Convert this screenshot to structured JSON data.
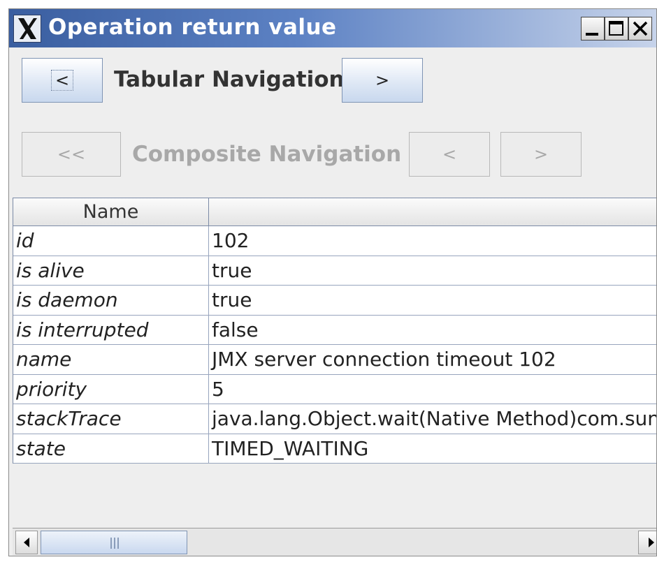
{
  "window": {
    "title": "Operation return value",
    "icon": "x-app-icon",
    "controls": [
      "minimize-icon",
      "maximize-icon",
      "close-icon"
    ]
  },
  "tabular_nav": {
    "prev_label": "<",
    "label": "Tabular Navigation",
    "next_label": ">"
  },
  "composite_nav": {
    "first_label": "<<",
    "label": "Composite Navigation",
    "prev_label": "<",
    "next_label": ">",
    "enabled": false
  },
  "table": {
    "columns": [
      "Name",
      ""
    ],
    "rows": [
      {
        "name": "id",
        "value": "102"
      },
      {
        "name": "is alive",
        "value": "true"
      },
      {
        "name": "is daemon",
        "value": "true"
      },
      {
        "name": "is interrupted",
        "value": "false"
      },
      {
        "name": "name",
        "value": "JMX server connection timeout 102"
      },
      {
        "name": "priority",
        "value": "5"
      },
      {
        "name": "stackTrace",
        "value": "java.lang.Object.wait(Native Method)com.sun.jmx.remote.internal.ServerCommunicatorAdmin$Timeout.run"
      },
      {
        "name": "state",
        "value": "TIMED_WAITING"
      }
    ]
  },
  "colors": {
    "title_start": "#3a5ea0",
    "title_end": "#c6d3ea",
    "window_bg": "#eeeeee",
    "grid_line": "#97a4bd"
  }
}
